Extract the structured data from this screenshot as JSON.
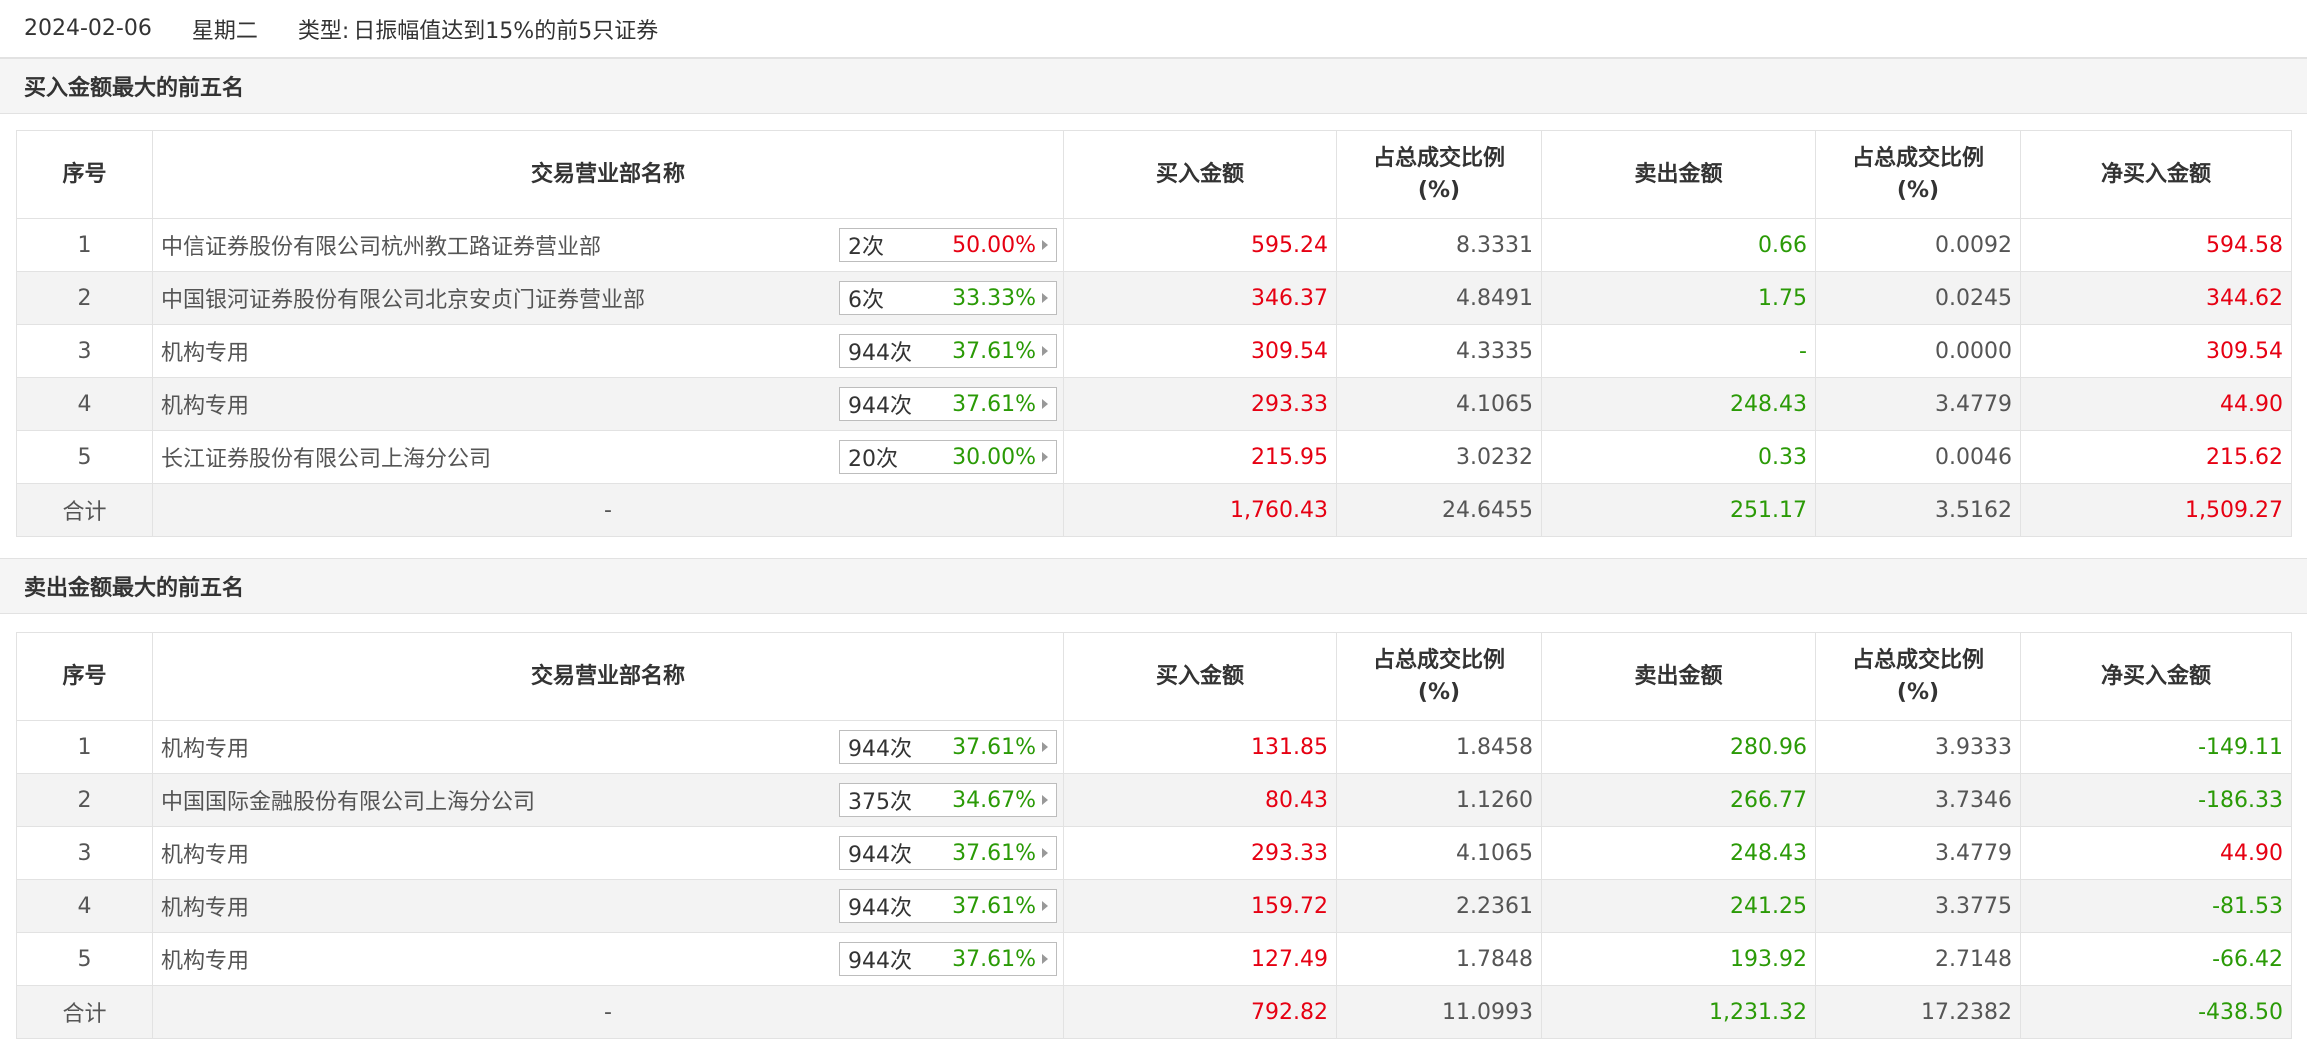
{
  "top": {
    "date": "2024-02-06",
    "weekday": "星期二",
    "type_label": "类型:",
    "type_value": "日振幅值达到15%的前5只证券"
  },
  "colors": {
    "red": "#e60012",
    "green": "#2a9a06"
  },
  "columns": [
    "序号",
    "交易营业部名称",
    "买入金额",
    "占总成交比例",
    "(%)",
    "卖出金额",
    "占总成交比例",
    "(%)",
    "净买入金额"
  ],
  "buy": {
    "title": "买入金额最大的前五名",
    "rows": [
      {
        "idx": "1",
        "name": "中信证券股份有限公司杭州教工路证券营业部",
        "times": "2次",
        "rate": "50.00%",
        "rate_red": true,
        "buy": "595.24",
        "buy_pct": "8.3331",
        "sell": "0.66",
        "sell_pct": "0.0092",
        "net": "594.58",
        "net_red": true
      },
      {
        "idx": "2",
        "name": "中国银河证券股份有限公司北京安贞门证券营业部",
        "times": "6次",
        "rate": "33.33%",
        "rate_red": false,
        "buy": "346.37",
        "buy_pct": "4.8491",
        "sell": "1.75",
        "sell_pct": "0.0245",
        "net": "344.62",
        "net_red": true
      },
      {
        "idx": "3",
        "name": "机构专用",
        "times": "944次",
        "rate": "37.61%",
        "rate_red": false,
        "buy": "309.54",
        "buy_pct": "4.3335",
        "sell": "-",
        "sell_pct": "0.0000",
        "net": "309.54",
        "net_red": true
      },
      {
        "idx": "4",
        "name": "机构专用",
        "times": "944次",
        "rate": "37.61%",
        "rate_red": false,
        "buy": "293.33",
        "buy_pct": "4.1065",
        "sell": "248.43",
        "sell_pct": "3.4779",
        "net": "44.90",
        "net_red": true
      },
      {
        "idx": "5",
        "name": "长江证券股份有限公司上海分公司",
        "times": "20次",
        "rate": "30.00%",
        "rate_red": false,
        "buy": "215.95",
        "buy_pct": "3.0232",
        "sell": "0.33",
        "sell_pct": "0.0046",
        "net": "215.62",
        "net_red": true
      }
    ],
    "total": {
      "label": "合计",
      "name": "-",
      "buy": "1,760.43",
      "buy_pct": "24.6455",
      "sell": "251.17",
      "sell_pct": "3.5162",
      "net": "1,509.27",
      "net_red": true
    }
  },
  "sell": {
    "title": "卖出金额最大的前五名",
    "rows": [
      {
        "idx": "1",
        "name": "机构专用",
        "times": "944次",
        "rate": "37.61%",
        "rate_red": false,
        "buy": "131.85",
        "buy_pct": "1.8458",
        "sell": "280.96",
        "sell_pct": "3.9333",
        "net": "-149.11",
        "net_red": false
      },
      {
        "idx": "2",
        "name": "中国国际金融股份有限公司上海分公司",
        "times": "375次",
        "rate": "34.67%",
        "rate_red": false,
        "buy": "80.43",
        "buy_pct": "1.1260",
        "sell": "266.77",
        "sell_pct": "3.7346",
        "net": "-186.33",
        "net_red": false
      },
      {
        "idx": "3",
        "name": "机构专用",
        "times": "944次",
        "rate": "37.61%",
        "rate_red": false,
        "buy": "293.33",
        "buy_pct": "4.1065",
        "sell": "248.43",
        "sell_pct": "3.4779",
        "net": "44.90",
        "net_red": true
      },
      {
        "idx": "4",
        "name": "机构专用",
        "times": "944次",
        "rate": "37.61%",
        "rate_red": false,
        "buy": "159.72",
        "buy_pct": "2.2361",
        "sell": "241.25",
        "sell_pct": "3.3775",
        "net": "-81.53",
        "net_red": false
      },
      {
        "idx": "5",
        "name": "机构专用",
        "times": "944次",
        "rate": "37.61%",
        "rate_red": false,
        "buy": "127.49",
        "buy_pct": "1.7848",
        "sell": "193.92",
        "sell_pct": "2.7148",
        "net": "-66.42",
        "net_red": false
      }
    ],
    "total": {
      "label": "合计",
      "name": "-",
      "buy": "792.82",
      "buy_pct": "11.0993",
      "sell": "1,231.32",
      "sell_pct": "17.2382",
      "net": "-438.50",
      "net_red": false
    }
  }
}
